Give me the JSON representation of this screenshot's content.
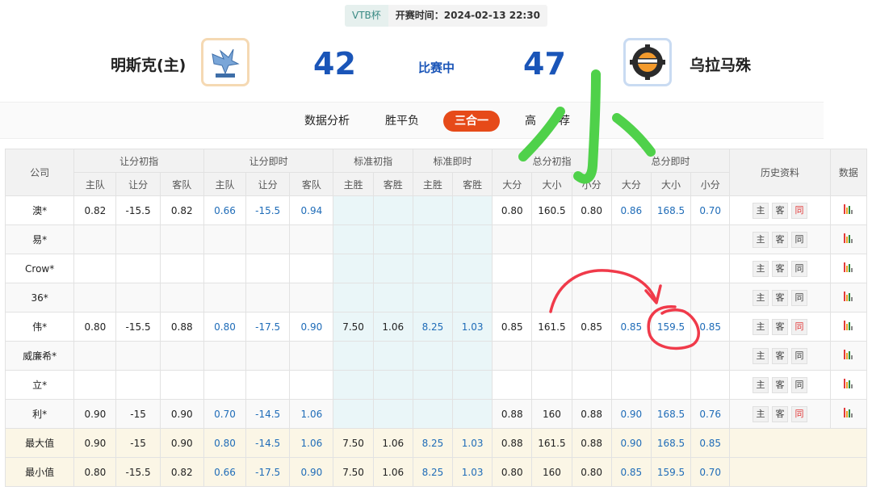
{
  "header": {
    "league": "VTB杯",
    "kickoff": "开赛时间：2024-02-13 22:30",
    "home_team": "明斯克(主)",
    "away_team": "乌拉马殊",
    "home_score": "42",
    "away_score": "47",
    "status": "比赛中"
  },
  "tabs": [
    "数据分析",
    "胜平负",
    "三合一",
    "高",
    "荐"
  ],
  "active_tab": "三合一",
  "table": {
    "group_headers": [
      "公司",
      "让分初指",
      "让分即时",
      "标准初指",
      "标准即时",
      "总分初指",
      "总分即时",
      "历史资料",
      "数据"
    ],
    "sub_headers": [
      "主队",
      "让分",
      "客队",
      "主队",
      "让分",
      "客队",
      "主胜",
      "客胜",
      "主胜",
      "客胜",
      "大分",
      "大小",
      "小分",
      "大分",
      "大小",
      "小分"
    ],
    "history_buttons": [
      "主",
      "客",
      "同"
    ],
    "rows": [
      {
        "company": "澳*",
        "cells": [
          "0.82",
          "-15.5",
          "0.82",
          "0.66",
          "-15.5",
          "0.94",
          "",
          "",
          "",
          "",
          "0.80",
          "160.5",
          "0.80",
          "0.86",
          "168.5",
          "0.70"
        ],
        "same_red": true
      },
      {
        "company": "易*",
        "cells": [
          "",
          "",
          "",
          "",
          "",
          "",
          "",
          "",
          "",
          "",
          "",
          "",
          "",
          "",
          "",
          ""
        ],
        "same_red": false
      },
      {
        "company": "Crow*",
        "cells": [
          "",
          "",
          "",
          "",
          "",
          "",
          "",
          "",
          "",
          "",
          "",
          "",
          "",
          "",
          "",
          ""
        ],
        "same_red": false
      },
      {
        "company": "36*",
        "cells": [
          "",
          "",
          "",
          "",
          "",
          "",
          "",
          "",
          "",
          "",
          "",
          "",
          "",
          "",
          "",
          ""
        ],
        "same_red": false
      },
      {
        "company": "伟*",
        "cells": [
          "0.80",
          "-15.5",
          "0.88",
          "0.80",
          "-17.5",
          "0.90",
          "7.50",
          "1.06",
          "8.25",
          "1.03",
          "0.85",
          "161.5",
          "0.85",
          "0.85",
          "159.5",
          "0.85"
        ],
        "same_red": true
      },
      {
        "company": "威廉希*",
        "cells": [
          "",
          "",
          "",
          "",
          "",
          "",
          "",
          "",
          "",
          "",
          "",
          "",
          "",
          "",
          "",
          ""
        ],
        "same_red": false
      },
      {
        "company": "立*",
        "cells": [
          "",
          "",
          "",
          "",
          "",
          "",
          "",
          "",
          "",
          "",
          "",
          "",
          "",
          "",
          "",
          ""
        ],
        "same_red": false
      },
      {
        "company": "利*",
        "cells": [
          "0.90",
          "-15",
          "0.90",
          "0.70",
          "-14.5",
          "1.06",
          "",
          "",
          "",
          "",
          "0.88",
          "160",
          "0.88",
          "0.90",
          "168.5",
          "0.76"
        ],
        "same_red": true
      }
    ],
    "summary": [
      {
        "label": "最大值",
        "cells": [
          "0.90",
          "-15",
          "0.90",
          "0.80",
          "-14.5",
          "1.06",
          "7.50",
          "1.06",
          "8.25",
          "1.03",
          "0.88",
          "161.5",
          "0.88",
          "0.90",
          "168.5",
          "0.85"
        ]
      },
      {
        "label": "最小值",
        "cells": [
          "0.80",
          "-15.5",
          "0.82",
          "0.66",
          "-17.5",
          "0.90",
          "7.50",
          "1.06",
          "8.25",
          "1.03",
          "0.80",
          "160",
          "0.80",
          "0.85",
          "159.5",
          "0.70"
        ]
      }
    ]
  },
  "annotation": {
    "handwritten_text": "小",
    "colors": {
      "green": "#4fd14a",
      "red": "#f03a4a"
    }
  },
  "colors": {
    "accent": "#e64a19",
    "score_blue": "#1a55b8",
    "odds_blue": "#1f6cb8"
  }
}
